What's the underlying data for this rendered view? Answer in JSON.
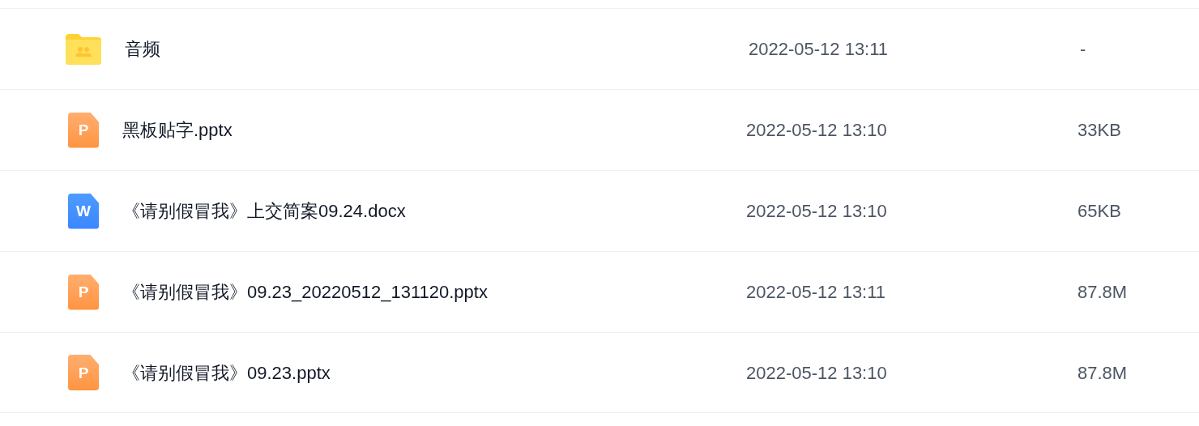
{
  "files": [
    {
      "kind": "folder",
      "name": "音频",
      "modified": "2022-05-12 13:11",
      "size": "-"
    },
    {
      "kind": "slides",
      "badge": "P",
      "name": "黑板贴字.pptx",
      "modified": "2022-05-12 13:10",
      "size": "33KB"
    },
    {
      "kind": "document",
      "badge": "W",
      "name": "《请别假冒我》上交简案09.24.docx",
      "modified": "2022-05-12 13:10",
      "size": "65KB"
    },
    {
      "kind": "slides",
      "badge": "P",
      "name": "《请别假冒我》09.23_20220512_131120.pptx",
      "modified": "2022-05-12 13:11",
      "size": "87.8M"
    },
    {
      "kind": "slides",
      "badge": "P",
      "name": "《请别假冒我》09.23.pptx",
      "modified": "2022-05-12 13:10",
      "size": "87.8M"
    }
  ]
}
